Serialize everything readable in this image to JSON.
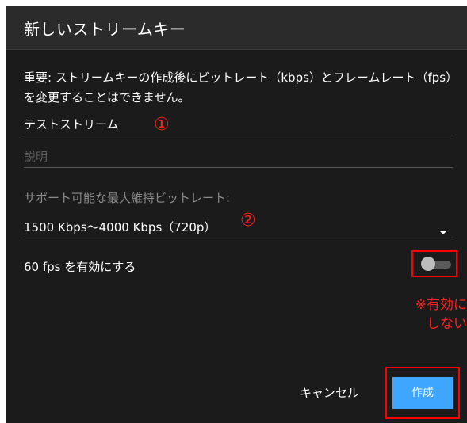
{
  "dialog": {
    "title": "新しいストリームキー",
    "notice": "重要: ストリームキーの作成後にビットレート（kbps）とフレームレート（fps）を変更することはできません。"
  },
  "form": {
    "name_value": "テストストリーム",
    "description_placeholder": "説明",
    "bitrate_label": "サポート可能な最大維持ビットレート:",
    "bitrate_value": "1500 Kbps〜4000 Kbps（720p）",
    "fps_label": "60 fps を有効にする",
    "fps_enabled": false
  },
  "annotations": {
    "marker_1": "①",
    "marker_2": "②",
    "note_line1": "※有効に",
    "note_line2": "しない"
  },
  "buttons": {
    "cancel": "キャンセル",
    "create": "作成"
  },
  "colors": {
    "dialog_bg": "#1b1b1b",
    "header_bg": "#2b2b2b",
    "accent": "#3ea6ff",
    "annotation_red": "#ff0000"
  },
  "icons": {
    "dropdown": "caret-down-icon",
    "toggle": "toggle-switch"
  }
}
